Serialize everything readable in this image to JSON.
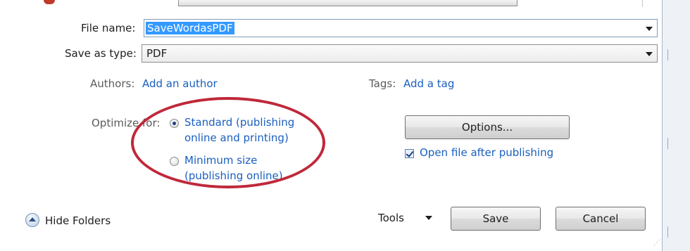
{
  "file_name": {
    "label": "File name:",
    "value": "SaveWordasPDF"
  },
  "save_as_type": {
    "label": "Save as type:",
    "value": "PDF"
  },
  "authors": {
    "label": "Authors:",
    "link": "Add an author"
  },
  "tags": {
    "label": "Tags:",
    "link": "Add a tag"
  },
  "optimize": {
    "label": "Optimize for:",
    "standard_line1": "Standard (publishing",
    "standard_line2": "online and printing)",
    "minimum_line1": "Minimum size",
    "minimum_line2": "(publishing online)",
    "selected": "standard"
  },
  "options_button": "Options...",
  "open_after": {
    "label": "Open file after publishing",
    "checked": true
  },
  "footer": {
    "hide_folders": "Hide Folders",
    "tools": "Tools",
    "save": "Save",
    "cancel": "Cancel"
  },
  "colors": {
    "link": "#1a5fbf",
    "highlight": "#c0283a",
    "selection": "#3399ff"
  }
}
